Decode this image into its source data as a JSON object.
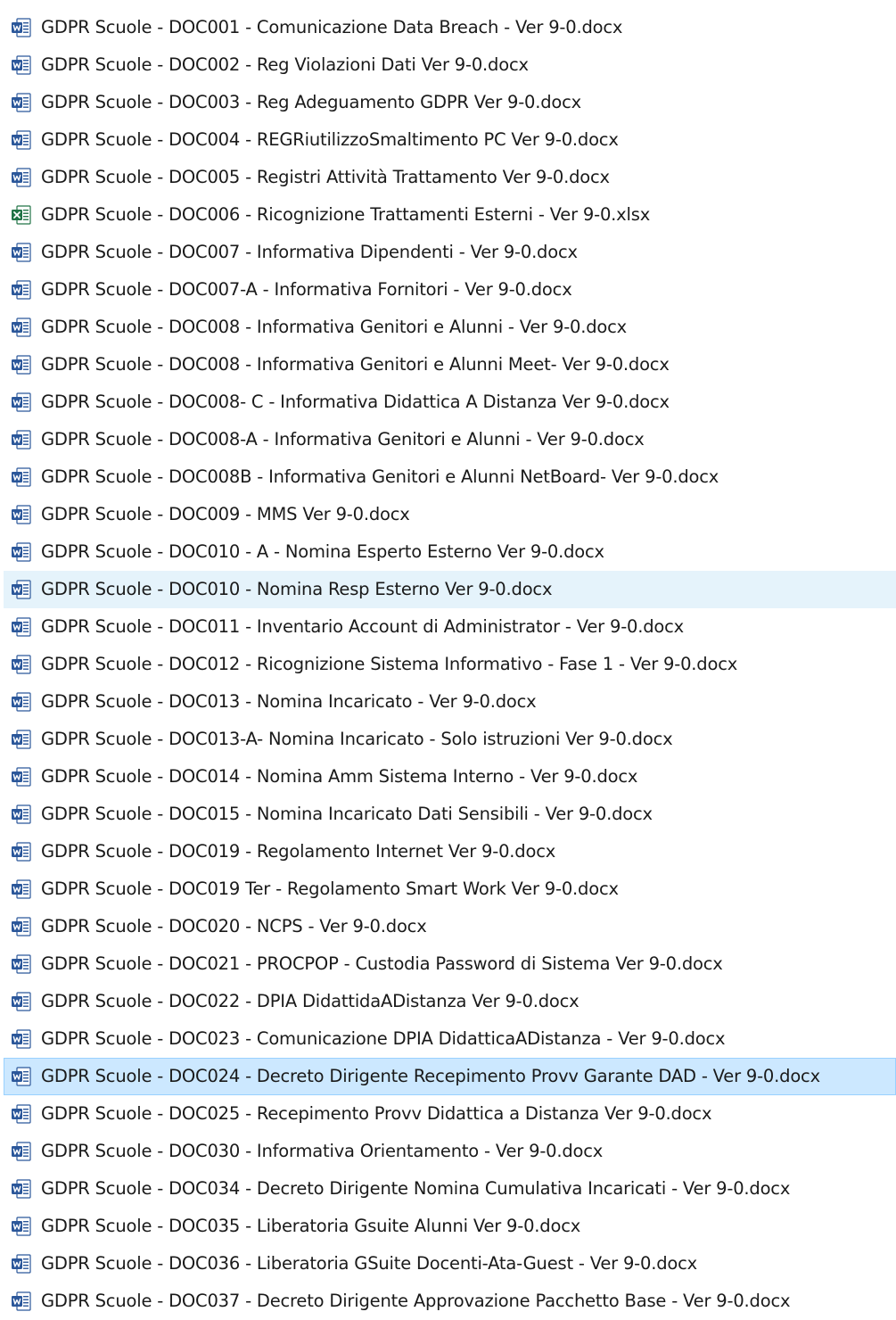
{
  "colors": {
    "word_icon": "#2b579a",
    "excel_icon": "#217346",
    "hover_row": "#e5f3fb",
    "selected_row": "#cce8ff",
    "selected_border": "#99d1ff"
  },
  "files": [
    {
      "name": "GDPR Scuole - DOC001 - Comunicazione Data Breach - Ver 9-0.docx",
      "icon": "word-document-icon",
      "state": ""
    },
    {
      "name": "GDPR Scuole - DOC002 - Reg Violazioni Dati Ver 9-0.docx",
      "icon": "word-document-icon",
      "state": ""
    },
    {
      "name": "GDPR Scuole - DOC003 - Reg Adeguamento GDPR Ver 9-0.docx",
      "icon": "word-document-icon",
      "state": ""
    },
    {
      "name": "GDPR Scuole - DOC004 - REGRiutilizzoSmaltimento PC Ver 9-0.docx",
      "icon": "word-document-icon",
      "state": ""
    },
    {
      "name": "GDPR Scuole - DOC005 - Registri Attività Trattamento Ver 9-0.docx",
      "icon": "word-document-icon",
      "state": ""
    },
    {
      "name": "GDPR Scuole - DOC006 - Ricognizione Trattamenti Esterni - Ver 9-0.xlsx",
      "icon": "excel-spreadsheet-icon",
      "state": ""
    },
    {
      "name": "GDPR Scuole - DOC007 - Informativa Dipendenti - Ver 9-0.docx",
      "icon": "word-document-icon",
      "state": ""
    },
    {
      "name": "GDPR Scuole - DOC007-A - Informativa Fornitori - Ver 9-0.docx",
      "icon": "word-document-icon",
      "state": ""
    },
    {
      "name": "GDPR Scuole - DOC008 - Informativa Genitori e Alunni - Ver 9-0.docx",
      "icon": "word-document-icon",
      "state": ""
    },
    {
      "name": "GDPR Scuole - DOC008 - Informativa Genitori e Alunni Meet- Ver 9-0.docx",
      "icon": "word-document-icon",
      "state": ""
    },
    {
      "name": "GDPR Scuole - DOC008- C - Informativa Didattica A Distanza Ver 9-0.docx",
      "icon": "word-document-icon",
      "state": ""
    },
    {
      "name": "GDPR Scuole - DOC008-A - Informativa Genitori e Alunni - Ver 9-0.docx",
      "icon": "word-document-icon",
      "state": ""
    },
    {
      "name": "GDPR Scuole - DOC008B - Informativa Genitori e Alunni NetBoard- Ver 9-0.docx",
      "icon": "word-document-icon",
      "state": ""
    },
    {
      "name": "GDPR Scuole - DOC009 - MMS Ver 9-0.docx",
      "icon": "word-document-icon",
      "state": ""
    },
    {
      "name": "GDPR Scuole - DOC010 - A - Nomina Esperto Esterno Ver 9-0.docx",
      "icon": "word-document-icon",
      "state": ""
    },
    {
      "name": "GDPR Scuole - DOC010 - Nomina Resp Esterno Ver 9-0.docx",
      "icon": "word-document-icon",
      "state": "hover"
    },
    {
      "name": "GDPR Scuole - DOC011 - Inventario Account di Administrator - Ver 9-0.docx",
      "icon": "word-document-icon",
      "state": ""
    },
    {
      "name": "GDPR Scuole - DOC012 - Ricognizione Sistema Informativo - Fase 1 - Ver 9-0.docx",
      "icon": "word-document-icon",
      "state": ""
    },
    {
      "name": "GDPR Scuole - DOC013 - Nomina Incaricato - Ver 9-0.docx",
      "icon": "word-document-icon",
      "state": ""
    },
    {
      "name": "GDPR Scuole - DOC013-A- Nomina Incaricato - Solo istruzioni Ver 9-0.docx",
      "icon": "word-document-icon",
      "state": ""
    },
    {
      "name": "GDPR Scuole - DOC014 - Nomina Amm Sistema Interno - Ver 9-0.docx",
      "icon": "word-document-icon",
      "state": ""
    },
    {
      "name": "GDPR Scuole - DOC015 - Nomina Incaricato Dati Sensibili - Ver 9-0.docx",
      "icon": "word-document-icon",
      "state": ""
    },
    {
      "name": "GDPR Scuole - DOC019 - Regolamento Internet Ver 9-0.docx",
      "icon": "word-document-icon",
      "state": ""
    },
    {
      "name": "GDPR Scuole - DOC019 Ter - Regolamento Smart Work Ver 9-0.docx",
      "icon": "word-document-icon",
      "state": ""
    },
    {
      "name": "GDPR Scuole - DOC020 - NCPS - Ver 9-0.docx",
      "icon": "word-document-icon",
      "state": ""
    },
    {
      "name": "GDPR Scuole - DOC021 - PROCPOP - Custodia Password di Sistema Ver 9-0.docx",
      "icon": "word-document-icon",
      "state": ""
    },
    {
      "name": "GDPR Scuole - DOC022 - DPIA DidattidaADistanza Ver 9-0.docx",
      "icon": "word-document-icon",
      "state": ""
    },
    {
      "name": "GDPR Scuole - DOC023 - Comunicazione DPIA DidatticaADistanza - Ver 9-0.docx",
      "icon": "word-document-icon",
      "state": ""
    },
    {
      "name": "GDPR Scuole - DOC024 - Decreto Dirigente Recepimento Provv Garante DAD - Ver 9-0.docx",
      "icon": "word-document-icon",
      "state": "selected"
    },
    {
      "name": "GDPR Scuole - DOC025 - Recepimento Provv Didattica a Distanza  Ver 9-0.docx",
      "icon": "word-document-icon",
      "state": ""
    },
    {
      "name": "GDPR Scuole - DOC030 - Informativa Orientamento - Ver 9-0.docx",
      "icon": "word-document-icon",
      "state": ""
    },
    {
      "name": "GDPR Scuole - DOC034 - Decreto Dirigente Nomina Cumulativa Incaricati - Ver 9-0.docx",
      "icon": "word-document-icon",
      "state": ""
    },
    {
      "name": "GDPR Scuole - DOC035 - Liberatoria Gsuite Alunni Ver 9-0.docx",
      "icon": "word-document-icon",
      "state": ""
    },
    {
      "name": "GDPR Scuole - DOC036 - Liberatoria GSuite Docenti-Ata-Guest - Ver 9-0.docx",
      "icon": "word-document-icon",
      "state": ""
    },
    {
      "name": "GDPR Scuole - DOC037 - Decreto Dirigente Approvazione Pacchetto Base - Ver 9-0.docx",
      "icon": "word-document-icon",
      "state": ""
    }
  ]
}
